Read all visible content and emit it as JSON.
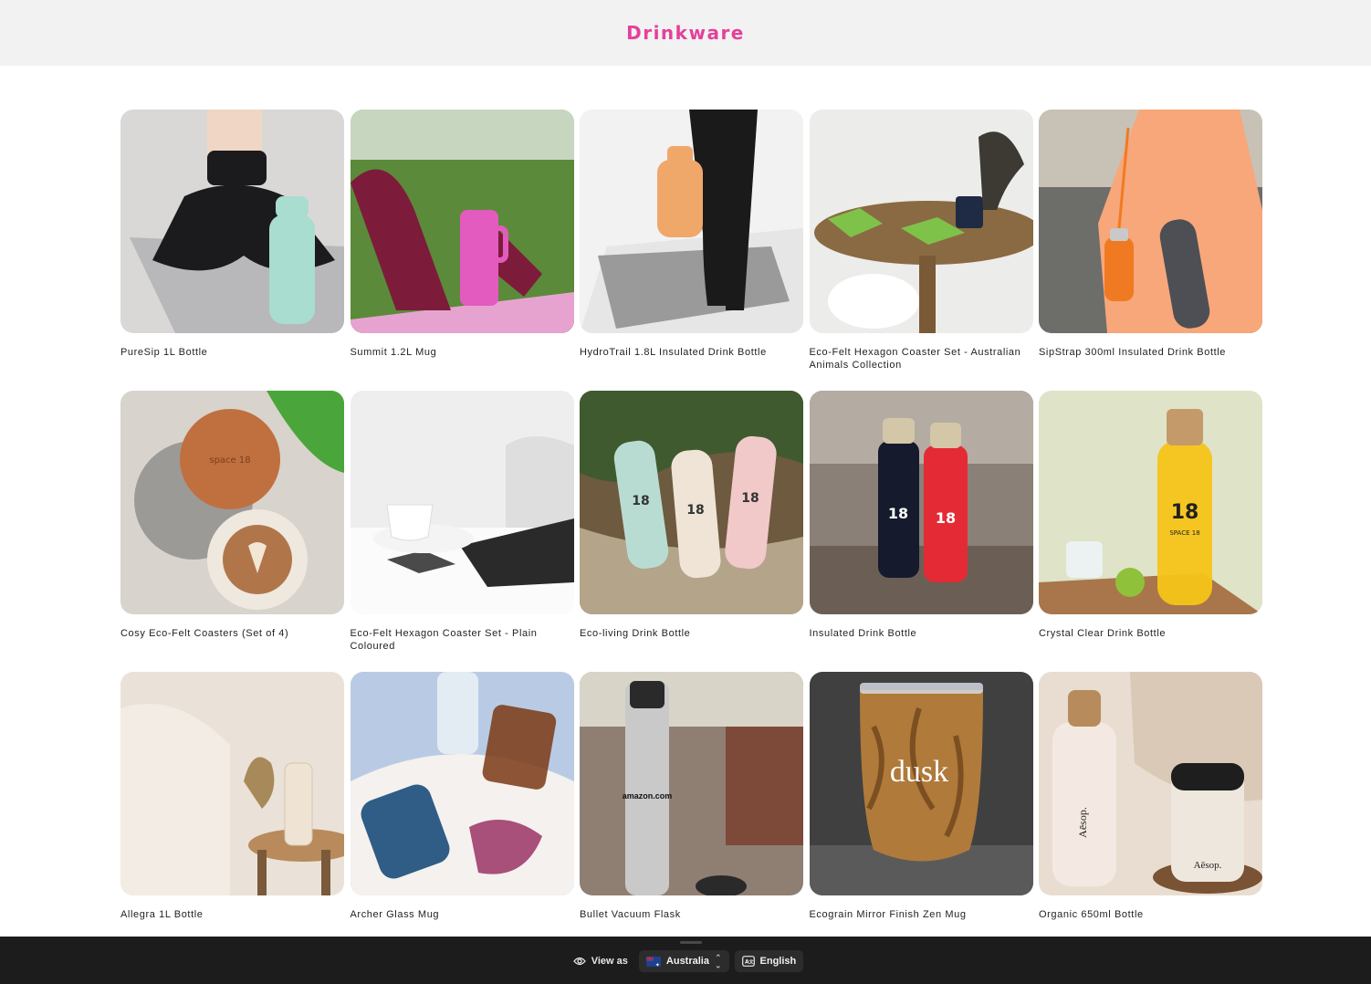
{
  "header": {
    "title": "Drinkware"
  },
  "products": [
    {
      "name": "PureSip 1L Bottle",
      "scene": "yoga-bottle",
      "colors": {
        "bg": "#d9d8d6",
        "floor": "#b8b8bb",
        "accent": "#a8ddd0",
        "dark": "#1b1b1e"
      }
    },
    {
      "name": "Summit 1.2L Mug",
      "scene": "park-tumbler",
      "colors": {
        "bg": "#5b8a3b",
        "floor": "#e7a3cf",
        "accent": "#e35bbf",
        "dark": "#7d1c3a"
      }
    },
    {
      "name": "HydroTrail 1.8L Insulated Drink Bottle",
      "scene": "studio-bottle",
      "colors": {
        "bg": "#f2f2f2",
        "floor": "#9a9a9a",
        "accent": "#f0a86a",
        "dark": "#1a1a1a"
      }
    },
    {
      "name": "Eco-Felt Hexagon Coaster Set - Australian Animals Collection",
      "scene": "table-coasters",
      "colors": {
        "bg": "#ececea",
        "floor": "#8a6a42",
        "accent": "#7fc24a",
        "dark": "#1f2a44"
      }
    },
    {
      "name": "SipStrap 300ml Insulated Drink Bottle",
      "scene": "strap-bottle",
      "colors": {
        "bg": "#6d6d6a",
        "floor": "#f7a77a",
        "accent": "#f07a22",
        "dark": "#4d4f55"
      }
    },
    {
      "name": "Cosy Eco-Felt Coasters (Set of 4)",
      "scene": "felt-coasters",
      "colors": {
        "bg": "#d8d3cc",
        "floor": "#9b9a97",
        "accent": "#c0703f",
        "dark": "#6b3f22"
      }
    },
    {
      "name": "Eco-Felt Hexagon Coaster Set - Plain Coloured",
      "scene": "white-desk",
      "colors": {
        "bg": "#eeeeee",
        "floor": "#fbfbfb",
        "accent": "#3c3c3c",
        "dark": "#2a2a2a"
      }
    },
    {
      "name": "Eco-living Drink Bottle",
      "scene": "tree-bottles",
      "colors": {
        "bg": "#6d5a3f",
        "floor": "#b3a48a",
        "accent": "#b9dcd2",
        "dark": "#3a2d1d"
      }
    },
    {
      "name": "Insulated Drink Bottle",
      "scene": "beach-bottles",
      "colors": {
        "bg": "#8a8078",
        "floor": "#6b5f55",
        "accent": "#e42b35",
        "dark": "#151a2d"
      }
    },
    {
      "name": "Crystal Clear Drink Bottle",
      "scene": "glass-bottle",
      "colors": {
        "bg": "#dfe3c8",
        "floor": "#a8764a",
        "accent": "#f5c418",
        "dark": "#5b3b20"
      }
    },
    {
      "name": "Allegra 1L Bottle",
      "scene": "bedroom-bottle",
      "colors": {
        "bg": "#eae2d8",
        "floor": "#b88a5c",
        "accent": "#efe3d3",
        "dark": "#7a5a3a"
      }
    },
    {
      "name": "Archer Glass Mug",
      "scene": "glass-mugs",
      "colors": {
        "bg": "#b9cbe4",
        "floor": "#f4f1ee",
        "accent": "#2f5d86",
        "dark": "#7a3a14"
      }
    },
    {
      "name": "Bullet Vacuum Flask",
      "scene": "steel-flask",
      "colors": {
        "bg": "#8f7f73",
        "floor": "#6c5c50",
        "accent": "#c9c9c9",
        "dark": "#2a2a2a"
      }
    },
    {
      "name": "Ecograin Mirror Finish Zen Mug",
      "scene": "wood-mug",
      "colors": {
        "bg": "#404040",
        "floor": "#5a5a5a",
        "accent": "#b07a3a",
        "dark": "#5a3214"
      }
    },
    {
      "name": "Organic 650ml Bottle",
      "scene": "aesop-bottle",
      "colors": {
        "bg": "#e8ddd0",
        "floor": "#7a5234",
        "accent": "#f4e9e2",
        "dark": "#1e1e1e"
      }
    }
  ],
  "product_image_texts": {
    "felt_coaster_logo": "space 18",
    "bottle_logo": "18",
    "bottle_logo_sub": "SPACE 18",
    "flask_brand": "amazon.com",
    "mug_brand": "dusk",
    "organic_brand": "Aēsop."
  },
  "footer": {
    "view_as_label": "View as",
    "country": "Australia",
    "language": "English"
  }
}
